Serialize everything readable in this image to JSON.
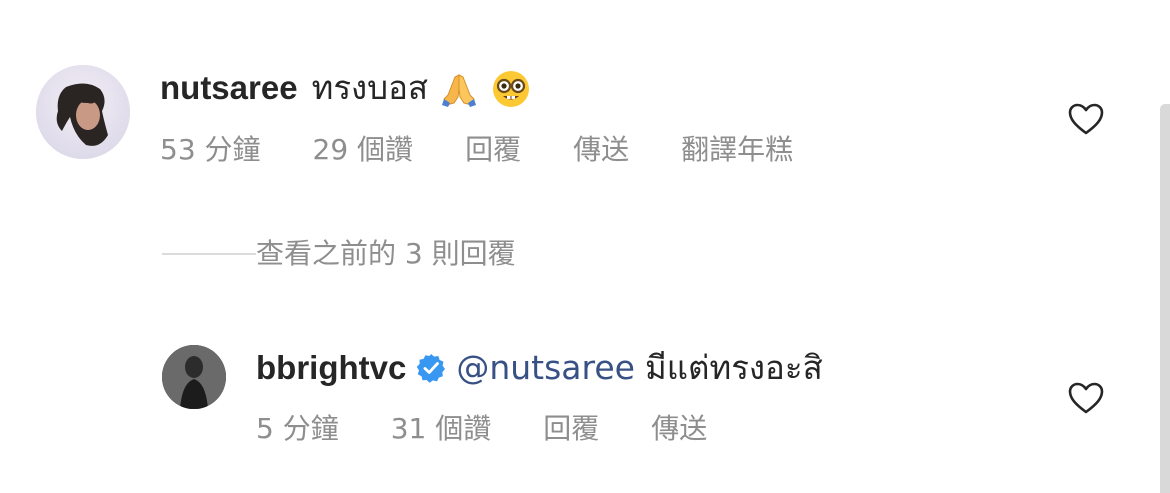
{
  "comments": [
    {
      "username": "nutsaree",
      "text": "ทรงบอส",
      "emojis": [
        "folded-hands-icon",
        "nerd-face-icon"
      ],
      "time": "53 分鐘",
      "likes": "29 個讚",
      "reply": "回覆",
      "send": "傳送",
      "translate": "翻譯年糕"
    },
    {
      "username": "bbrightvc",
      "verified": true,
      "mention": "@nutsaree",
      "text": "มีแต่ทรงอะสิ",
      "time": "5 分鐘",
      "likes": "31 個讚",
      "reply": "回覆",
      "send": "傳送"
    }
  ],
  "view_previous_replies": "查看之前的 3 則回覆",
  "colors": {
    "username": "#262626",
    "meta": "#8e8e8e",
    "mention": "#385185",
    "verified": "#3897f0"
  }
}
